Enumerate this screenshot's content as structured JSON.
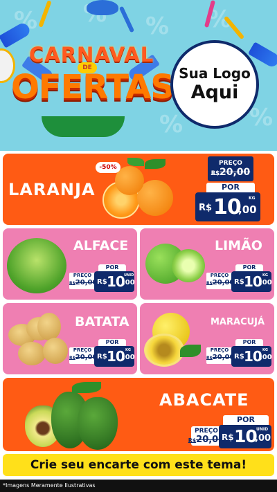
{
  "header": {
    "title_line1": "CARNAVAL",
    "title_de": "DE",
    "title_line2": "OFERTAS",
    "logo_line1": "Sua Logo",
    "logo_line2": "Aqui"
  },
  "colors": {
    "accent_orange": "#ff5b14",
    "accent_pink": "#ef7fb2",
    "price_navy": "#0f2a6b",
    "cta_yellow": "#ffe01a"
  },
  "products": [
    {
      "name": "LARANJA",
      "discount": "-50%",
      "preco_label": "PREÇO",
      "old_currency": "R$",
      "old_price": "20,00",
      "por_label": "POR",
      "currency": "R$",
      "price_int": "10",
      "price_cents": ",00",
      "unit": "KG"
    },
    {
      "name": "ALFACE",
      "preco_label": "PREÇO",
      "old_currency": "R$",
      "old_price": "20,00",
      "por_label": "POR",
      "currency": "R$",
      "price_int": "10",
      "price_cents": ",00",
      "unit": "UNID"
    },
    {
      "name": "LIMÃO",
      "preco_label": "PREÇO",
      "old_currency": "R$",
      "old_price": "20,00",
      "por_label": "POR",
      "currency": "R$",
      "price_int": "10",
      "price_cents": ",00",
      "unit": "KG"
    },
    {
      "name": "BATATA",
      "preco_label": "PREÇO",
      "old_currency": "R$",
      "old_price": "20,00",
      "por_label": "POR",
      "currency": "R$",
      "price_int": "10",
      "price_cents": ",00",
      "unit": "KG"
    },
    {
      "name": "MARACUJÁ",
      "preco_label": "PREÇO",
      "old_currency": "R$",
      "old_price": "20,00",
      "por_label": "POR",
      "currency": "R$",
      "price_int": "10",
      "price_cents": ",00",
      "unit": "KG"
    },
    {
      "name": "ABACATE",
      "preco_label": "PREÇO",
      "old_currency": "R$",
      "old_price": "20,00",
      "por_label": "POR",
      "currency": "R$",
      "price_int": "10",
      "price_cents": ",00",
      "unit": "UNID"
    }
  ],
  "cta": "Crie seu encarte com este tema!",
  "footer": "*Imagens Meramente Ilustrativas"
}
